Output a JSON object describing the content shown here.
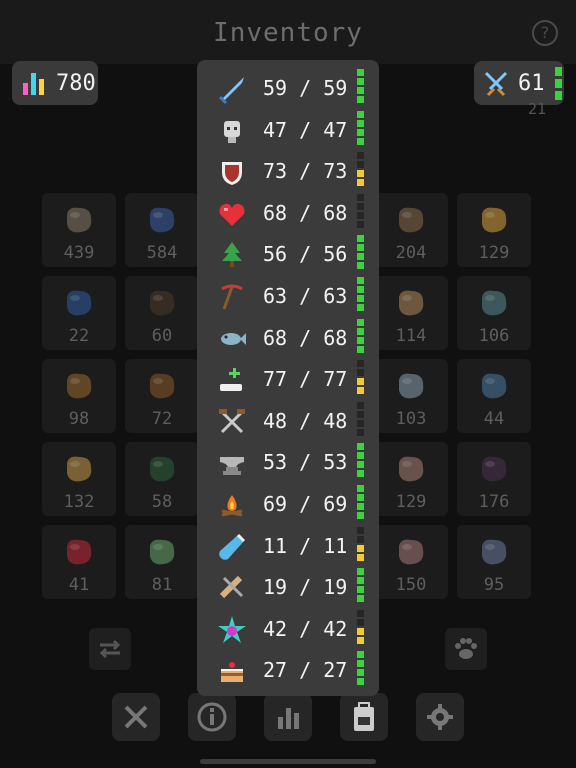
{
  "header": {
    "title": "Inventory",
    "help_icon": "question-circle-icon"
  },
  "badges": {
    "gems": {
      "value": "780",
      "icon": "bar-chart-gems-icon"
    },
    "swords": {
      "value": "61",
      "icon": "crossed-swords-icon",
      "energy_level": 1.0
    },
    "hidden_number": "21"
  },
  "grid": {
    "left_col1": [
      {
        "name": "raw-meat",
        "count": "439",
        "color": "#8a7a66"
      },
      {
        "name": "blue-gem-key",
        "count": "22",
        "color": "#2d5fa0"
      },
      {
        "name": "log",
        "count": "98",
        "color": "#9a6a30"
      },
      {
        "name": "wheat-bundle",
        "count": "132",
        "color": "#c79a4a"
      },
      {
        "name": "red-orb",
        "count": "41",
        "color": "#c4283a"
      }
    ],
    "left_col2": [
      {
        "name": "dark-staff",
        "count": "584",
        "color": "#3b5ea8"
      },
      {
        "name": "dark-log",
        "count": "60",
        "color": "#4a3a2a"
      },
      {
        "name": "split-log",
        "count": "72",
        "color": "#8a5a2a"
      },
      {
        "name": "green-crystals",
        "count": "58",
        "color": "#2e5e3a"
      },
      {
        "name": "green-herb",
        "count": "81",
        "color": "#6aa86a"
      }
    ],
    "right_col1": [
      {
        "name": "mushroom",
        "count": "204",
        "color": "#8a6a4a"
      },
      {
        "name": "meat-chunk",
        "count": "114",
        "color": "#b08a5a"
      },
      {
        "name": "ice-crystals",
        "count": "103",
        "color": "#8aa0b0"
      },
      {
        "name": "pink-rock",
        "count": "129",
        "color": "#a88070"
      },
      {
        "name": "ham",
        "count": "150",
        "color": "#a87a7a"
      }
    ],
    "right_col2": [
      {
        "name": "scroll",
        "count": "129",
        "color": "#d9a040"
      },
      {
        "name": "blue-fish",
        "count": "106",
        "color": "#5a8a90"
      },
      {
        "name": "blue-crystals",
        "count": "44",
        "color": "#4a7aa0"
      },
      {
        "name": "dark-ore",
        "count": "176",
        "color": "#4a3050"
      },
      {
        "name": "stone-pile",
        "count": "95",
        "color": "#6a7aa0"
      }
    ]
  },
  "side_buttons": {
    "swap": "swap-arrows-icon",
    "pet": "paw-icon"
  },
  "toolbar": [
    "crossed-swords-icon",
    "info-icon",
    "stats-icon",
    "backpack-icon",
    "gear-icon"
  ],
  "stats_panel": {
    "rows": [
      {
        "icon": "sword-icon",
        "value": "59 / 59",
        "meter": "green",
        "fill": 1.0
      },
      {
        "icon": "skull-helmet-icon",
        "value": "47 / 47",
        "meter": "green",
        "fill": 1.0
      },
      {
        "icon": "shield-icon",
        "value": "73 / 73",
        "meter": "yellow",
        "fill": 0.4
      },
      {
        "icon": "heart-icon",
        "value": "68 / 68",
        "meter": "red",
        "fill": 0.1
      },
      {
        "icon": "tree-icon",
        "value": "56 / 56",
        "meter": "green",
        "fill": 1.0
      },
      {
        "icon": "pickaxe-icon",
        "value": "63 / 63",
        "meter": "green",
        "fill": 1.0
      },
      {
        "icon": "fish-icon",
        "value": "68 / 68",
        "meter": "green",
        "fill": 1.0
      },
      {
        "icon": "healing-hand-icon",
        "value": "77 / 77",
        "meter": "yellow",
        "fill": 0.4
      },
      {
        "icon": "crossed-hammers-icon",
        "value": "48 / 48",
        "meter": "red",
        "fill": 0.1
      },
      {
        "icon": "anvil-icon",
        "value": "53 / 53",
        "meter": "green",
        "fill": 1.0
      },
      {
        "icon": "campfire-icon",
        "value": "69 / 69",
        "meter": "green",
        "fill": 1.0
      },
      {
        "icon": "potion-vial-icon",
        "value": "11 / 11",
        "meter": "yellow",
        "fill": 0.4
      },
      {
        "icon": "saw-hammer-icon",
        "value": "19 / 19",
        "meter": "green",
        "fill": 1.0
      },
      {
        "icon": "magic-gem-icon",
        "value": "42 / 42",
        "meter": "yellow",
        "fill": 0.4
      },
      {
        "icon": "cake-icon",
        "value": "27 / 27",
        "meter": "green",
        "fill": 1.0
      }
    ]
  },
  "colors": {
    "green": "#3ad43d",
    "yellow": "#f0cc2e",
    "red": "#e23b3b",
    "panel": "#3b3b3b"
  }
}
